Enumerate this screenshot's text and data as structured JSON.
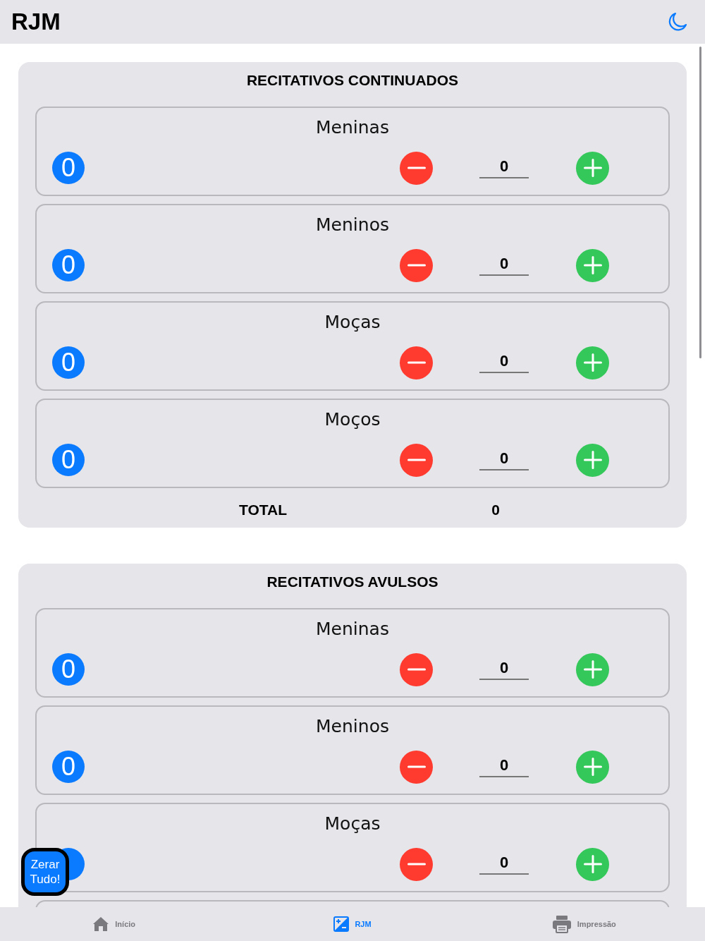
{
  "header": {
    "title": "RJM"
  },
  "sections": [
    {
      "title": "RECITATIVOS CONTINUADOS",
      "more_below": false,
      "counters": [
        {
          "label": "Meninas",
          "badge": "0",
          "count": "0"
        },
        {
          "label": "Meninos",
          "badge": "0",
          "count": "0"
        },
        {
          "label": "Moças",
          "badge": "0",
          "count": "0"
        },
        {
          "label": "Moços",
          "badge": "0",
          "count": "0"
        }
      ],
      "total": {
        "label": "TOTAL",
        "value": "0"
      }
    },
    {
      "title": "RECITATIVOS AVULSOS",
      "more_below": true,
      "counters": [
        {
          "label": "Meninas",
          "badge": "0",
          "count": "0"
        },
        {
          "label": "Meninos",
          "badge": "0",
          "count": "0"
        },
        {
          "label": "Moças",
          "count": "0"
        }
      ]
    }
  ],
  "reset_button": {
    "label": "Zerar Tudo!"
  },
  "tabs": [
    {
      "label": "Início",
      "selected": false
    },
    {
      "label": "RJM",
      "selected": true
    },
    {
      "label": "Impressão",
      "selected": false
    }
  ]
}
